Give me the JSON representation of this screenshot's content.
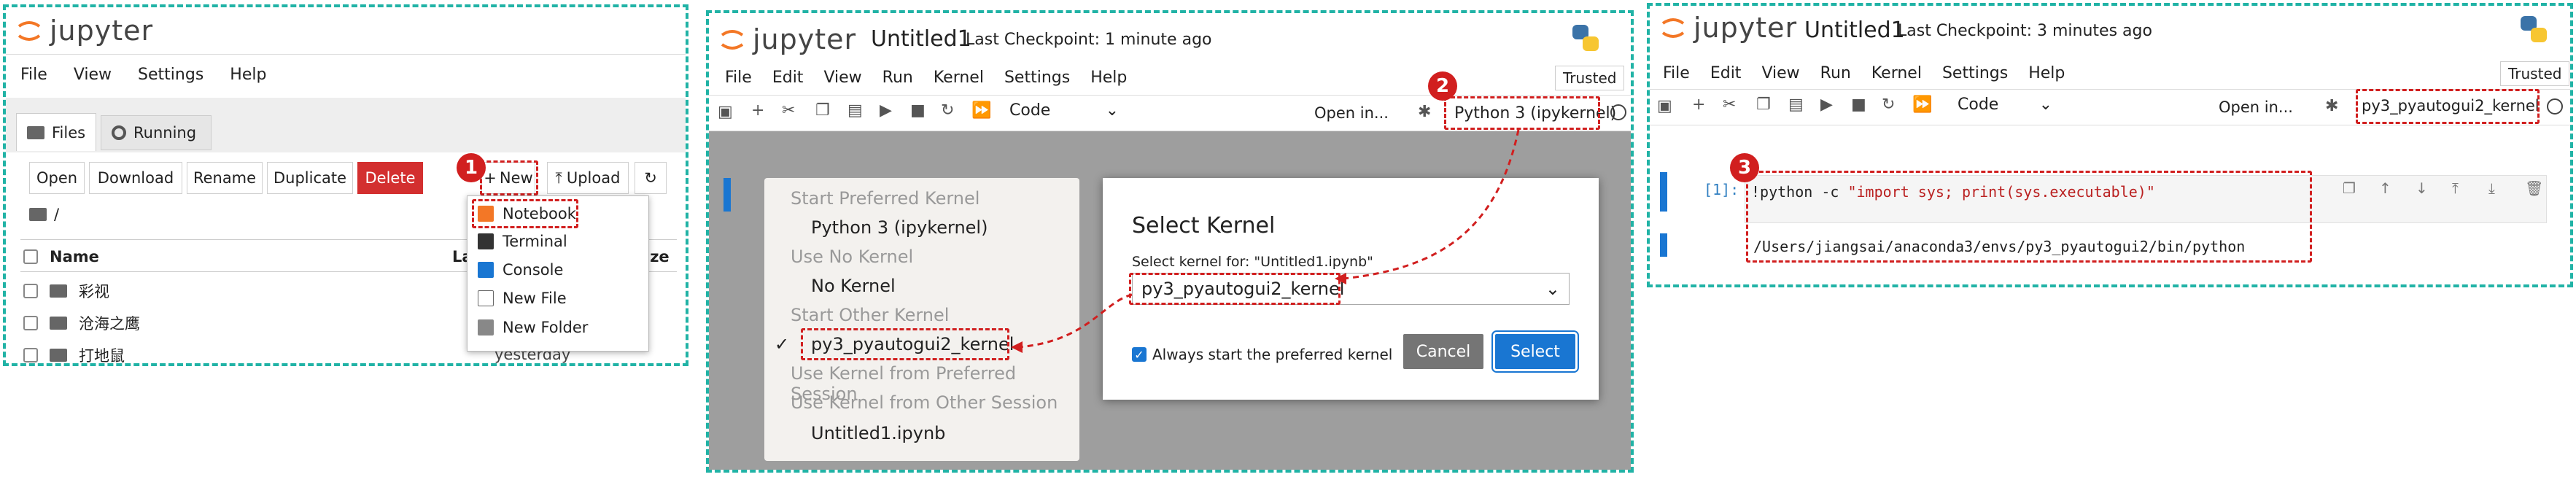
{
  "panel1": {
    "logo": "jupyter",
    "menu": [
      "File",
      "View",
      "Settings",
      "Help"
    ],
    "tabs": [
      "Files",
      "Running"
    ],
    "buttons": {
      "open": "Open",
      "download": "Download",
      "rename": "Rename",
      "duplicate": "Duplicate",
      "delete": "Delete",
      "new": "New",
      "upload": "Upload"
    },
    "path": "/",
    "columns": {
      "name": "Name",
      "last_modified": "La",
      "size": "ize"
    },
    "files": [
      {
        "name": "彩视",
        "modified": ""
      },
      {
        "name": "沧海之鹰",
        "modified": ""
      },
      {
        "name": "打地鼠",
        "modified": "yesterday"
      }
    ],
    "new_menu": [
      "Notebook",
      "Terminal",
      "Console",
      "New File",
      "New Folder"
    ],
    "marker": "1"
  },
  "panel2": {
    "logo": "jupyter",
    "notebook_name": "Untitled1",
    "checkpoint": "Last Checkpoint: 1 minute ago",
    "menu": [
      "File",
      "Edit",
      "View",
      "Run",
      "Kernel",
      "Settings",
      "Help"
    ],
    "trusted": "Trusted",
    "cell_type": "Code",
    "open_in": "Open in...",
    "kernel_button": "Python 3 (ipykernel)",
    "marker": "2",
    "kernel_list": {
      "start_preferred": "Start Preferred Kernel",
      "python3": "Python 3 (ipykernel)",
      "use_no": "Use No Kernel",
      "no_kernel": "No Kernel",
      "start_other": "Start Other Kernel",
      "pyautogui": "py3_pyautogui2_kernel",
      "use_preferred": "Use Kernel from Preferred Session",
      "use_other": "Use Kernel from Other Session",
      "untitled": "Untitled1.ipynb"
    },
    "dialog": {
      "title": "Select Kernel",
      "label": "Select kernel for: \"Untitled1.ipynb\"",
      "selected": "py3_pyautogui2_kernel",
      "always": "Always start the preferred kernel",
      "cancel": "Cancel",
      "select": "Select"
    }
  },
  "panel3": {
    "logo": "jupyter",
    "notebook_name": "Untitled1",
    "checkpoint": "Last Checkpoint: 3 minutes ago",
    "menu": [
      "File",
      "Edit",
      "View",
      "Run",
      "Kernel",
      "Settings",
      "Help"
    ],
    "trusted": "Trusted",
    "cell_type": "Code",
    "open_in": "Open in...",
    "kernel_name": "py3_pyautogui2_kernel",
    "prompt": "[1]:",
    "code_cmd": "!python -c ",
    "code_str": "\"import sys; print(sys.executable)\"",
    "output": "/Users/jiangsai/anaconda3/envs/py3_pyautogui2/bin/python",
    "marker": "3"
  },
  "colors": {
    "teal": "#21b3a6",
    "red": "#d11f1f",
    "orange": "#f37726",
    "blue": "#1976d2",
    "delete": "#d32f2f"
  }
}
